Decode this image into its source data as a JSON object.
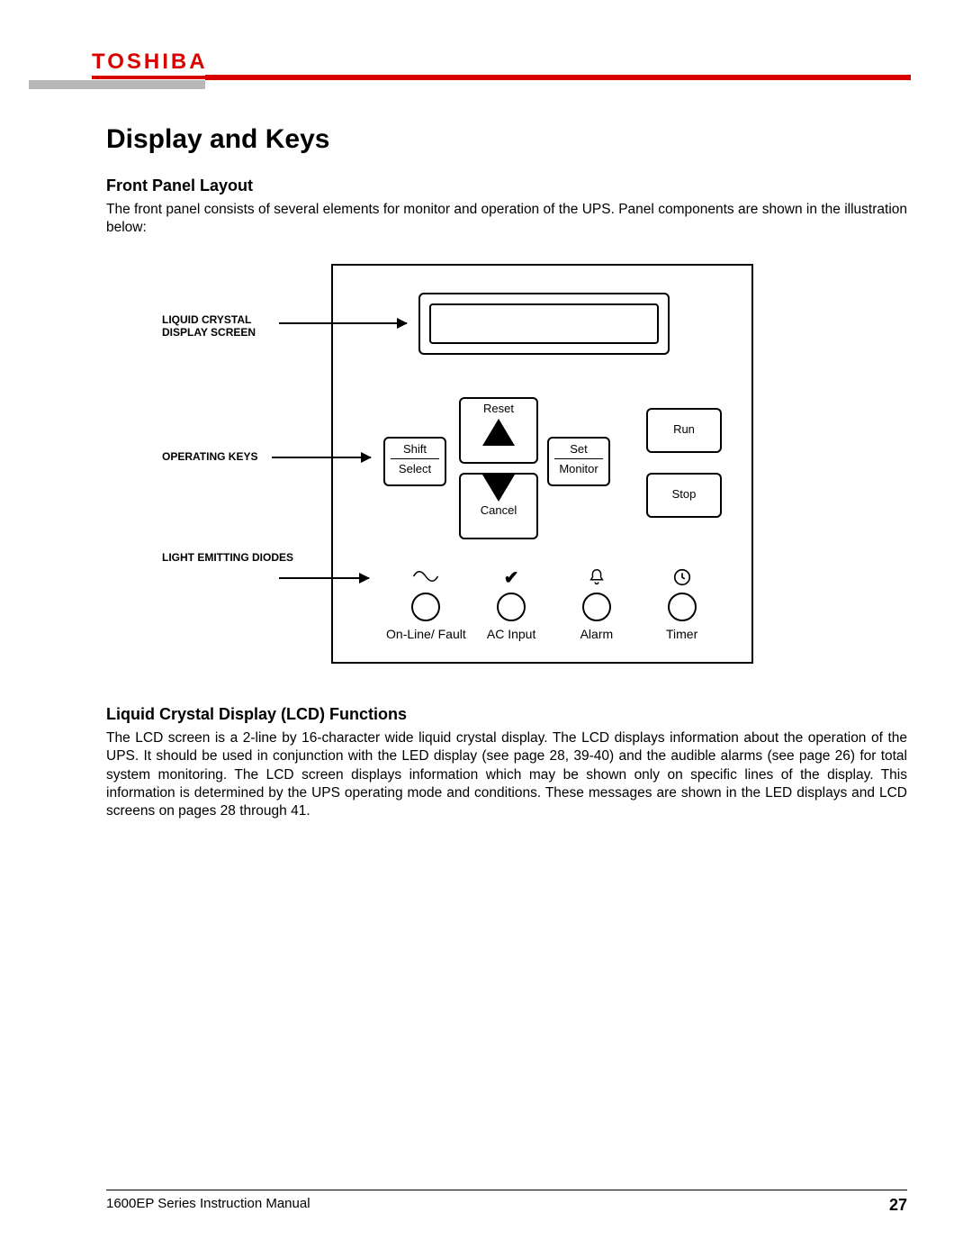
{
  "brand": "TOSHIBA",
  "page_title": "Display and Keys",
  "section1": {
    "heading": "Front Panel Layout",
    "paragraph": "The front panel consists of several elements for monitor and operation of the UPS.  Panel components are shown in the illustration below:"
  },
  "diagram": {
    "callouts": {
      "lcd": "LIQUID CRYSTAL DISPLAY SCREEN",
      "keys": "OPERATING KEYS",
      "leds": "LIGHT EMITTING DIODES"
    },
    "keys": {
      "reset": "Reset",
      "cancel": "Cancel",
      "shift_top": "Shift",
      "shift_bot": "Select",
      "set_top": "Set",
      "set_bot": "Monitor",
      "run": "Run",
      "stop": "Stop"
    },
    "leds": [
      {
        "icon": "sine",
        "label": "On-Line/ Fault"
      },
      {
        "icon": "check",
        "label": "AC Input"
      },
      {
        "icon": "bell",
        "label": "Alarm"
      },
      {
        "icon": "clock",
        "label": "Timer"
      }
    ]
  },
  "section2": {
    "heading": "Liquid Crystal Display (LCD) Functions",
    "paragraph": "The LCD screen is a 2-line by 16-character wide liquid crystal display. The LCD displays information about the operation of the UPS. It should be used in conjunction with the LED display (see page 28, 39-40) and the audible alarms (see page 26) for total system monitoring. The LCD screen displays information which may be shown only on specific lines of the display.  This information is determined by the UPS operating mode and conditions. These messages are shown in the LED displays and LCD screens on pages 28 through 41."
  },
  "footer": {
    "doc_title": "1600EP Series Instruction Manual",
    "page_number": "27"
  }
}
